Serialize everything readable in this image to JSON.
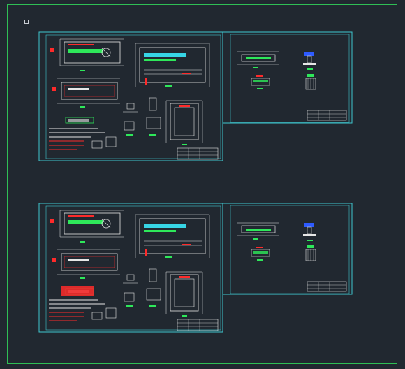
{
  "app": {
    "title": ""
  },
  "colors": {
    "background": "#212830",
    "frame_green": "#2fbf55",
    "sheet_cyan": "#3fc7cf",
    "drawing_white": "#e6e6e6",
    "highlight_green": "#2ee85a",
    "highlight_cyan": "#37d6e6",
    "highlight_red": "#ff2a2a",
    "highlight_blue": "#2e5bff"
  },
  "cursor": {
    "icon": "crosshair-cursor-icon"
  },
  "sheets": [
    {
      "id": "top-left",
      "title_block_text": ""
    },
    {
      "id": "top-right",
      "title_block_text": ""
    },
    {
      "id": "bottom-left",
      "title_block_text": ""
    },
    {
      "id": "bottom-right",
      "title_block_text": ""
    }
  ]
}
